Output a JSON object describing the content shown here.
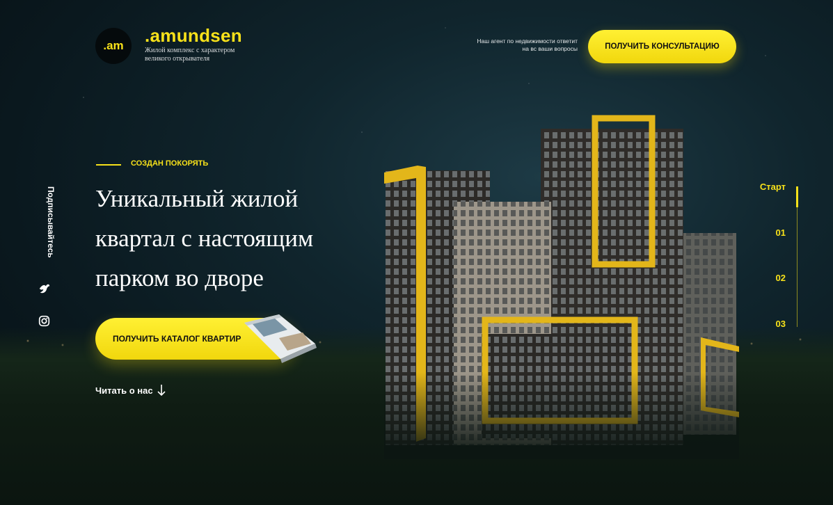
{
  "brand": {
    "logo_text": ".am",
    "name": ".amundsen",
    "tagline": "Жилой комплекс с характером великого открывателя",
    "accent_color": "#f7e11a"
  },
  "header": {
    "agent_text": "Наш агент по недвижимости ответит на вс ваши вопросы",
    "consult_button": "ПОЛУЧИТЬ КОНСУЛЬТАЦИЮ"
  },
  "social": {
    "subscribe_label": "Подписывайтесь",
    "icons": [
      "bird-icon",
      "instagram-icon"
    ]
  },
  "hero": {
    "eyebrow": "СОЗДАН ПОКОРЯТЬ",
    "title": "Уникальный жилой квартал с настоящим парком во дворе",
    "catalog_button": "ПОЛУЧИТЬ КАТАЛОГ КВАРТИР",
    "read_about": "Читать о нас"
  },
  "slide_nav": {
    "items": [
      "Старт",
      "01",
      "02",
      "03"
    ],
    "active": "Старт"
  }
}
